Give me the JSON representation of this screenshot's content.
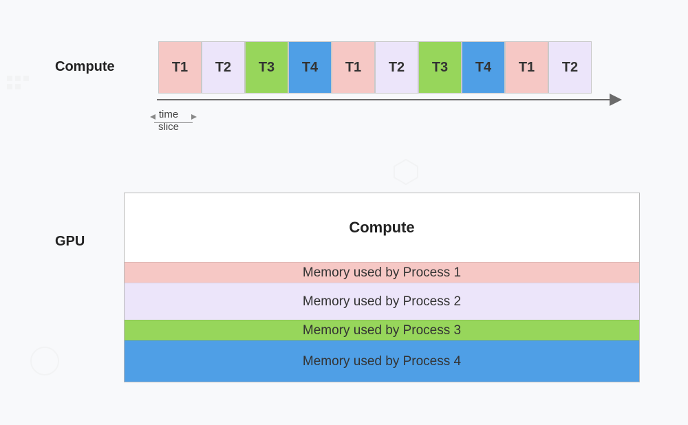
{
  "timeline": {
    "label": "Compute",
    "slots": [
      {
        "label": "T1",
        "color": 1
      },
      {
        "label": "T2",
        "color": 2
      },
      {
        "label": "T3",
        "color": 3
      },
      {
        "label": "T4",
        "color": 4
      },
      {
        "label": "T1",
        "color": 1
      },
      {
        "label": "T2",
        "color": 2
      },
      {
        "label": "T3",
        "color": 3
      },
      {
        "label": "T4",
        "color": 4
      },
      {
        "label": "T1",
        "color": 1
      },
      {
        "label": "T2",
        "color": 2
      }
    ],
    "slice_top": "time",
    "slice_bottom": "slice"
  },
  "gpu": {
    "label": "GPU",
    "compute_label": "Compute",
    "memory": [
      {
        "label": "Memory used by Process 1",
        "color": 1,
        "relative_height": 30
      },
      {
        "label": "Memory used by Process 2",
        "color": 2,
        "relative_height": 54
      },
      {
        "label": "Memory used by Process 3",
        "color": 3,
        "relative_height": 30
      },
      {
        "label": "Memory used by Process 4",
        "color": 4,
        "relative_height": 60
      }
    ]
  },
  "colors": {
    "1": "#f6c8c5",
    "2": "#ece5fa",
    "3": "#97d65b",
    "4": "#4f9fe6"
  }
}
